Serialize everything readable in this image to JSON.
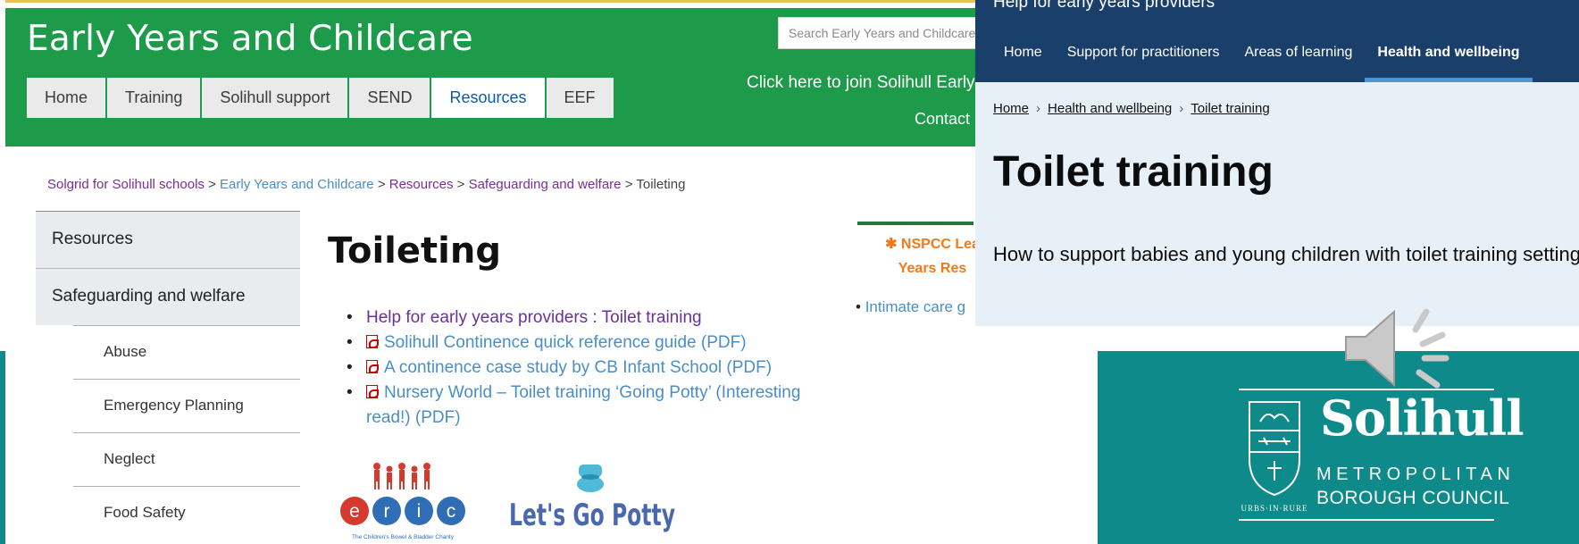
{
  "solgrid": {
    "site_title": "Early Years and Childcare",
    "search_placeholder": "Search Early Years and Childcare",
    "nav": [
      "Home",
      "Training",
      "Solihull support",
      "SEND",
      "Resources",
      "EEF"
    ],
    "join_text": "Click here to join Solihull Early",
    "contact_text": "Contact",
    "breadcrumb": {
      "item1": "Solgrid for Solihull schools",
      "item2": "Early Years and Childcare",
      "item3": "Resources",
      "item4": "Safeguarding and welfare",
      "current": "Toileting",
      "separator": ">"
    },
    "side_menu": {
      "top1": "Resources",
      "top2": "Safeguarding and welfare",
      "subs": [
        "Abuse",
        "Emergency Planning",
        "Neglect",
        "Food Safety"
      ]
    },
    "heading": "Toileting",
    "links": [
      "Help for early years providers : Toilet training",
      "Solihull Continence quick reference guide (PDF)",
      "A continence case study by CB Infant School (PDF)",
      "Nursery World – Toilet training ‘Going Potty’ (Interesting read!) (PDF)"
    ],
    "eric_tagline": "The Children's Bowel & Bladder Charity",
    "eric_letters": [
      "e",
      "r",
      "i",
      "c"
    ],
    "potty_text": "Let's Go Potty",
    "nspcc_line1": "✱ NSPCC Lea",
    "nspcc_line2": "Years Res",
    "intimate_link": "Intimate care g"
  },
  "gov": {
    "top_title": "Help for early years providers",
    "nav": [
      "Home",
      "Support for practitioners",
      "Areas of learning",
      "Health and wellbeing"
    ],
    "breadcrumb": [
      "Home",
      "Health and wellbeing",
      "Toilet training"
    ],
    "heading": "Toilet training",
    "lede": "How to support babies and young children with toilet training setting."
  },
  "council": {
    "word": "Solihull",
    "line2": "METROPOLITAN",
    "line3": "BOROUGH COUNCIL",
    "crest_motto": "URBS·IN·RURE"
  },
  "colors": {
    "solgrid_green": "#1e9b4a",
    "gov_blue": "#1b3f6b",
    "teal": "#0f8a8a",
    "link_blue": "#4a8ec8",
    "visited_purple": "#6b2fa0",
    "nspcc_orange": "#f07a1a"
  }
}
